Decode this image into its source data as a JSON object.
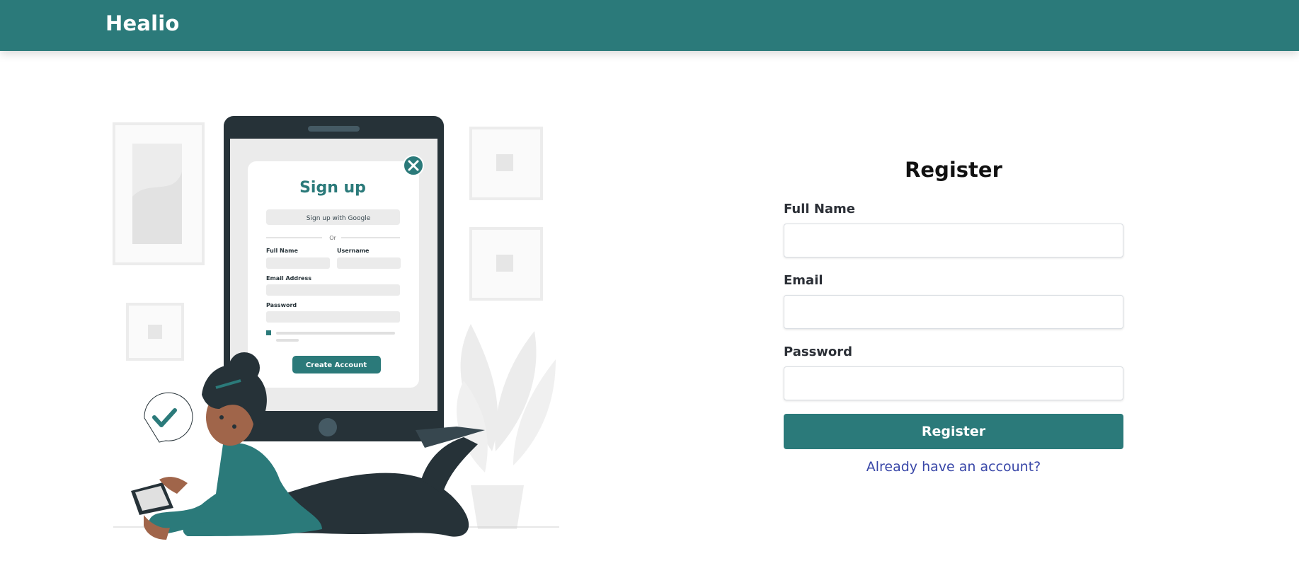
{
  "navbar": {
    "brand": "Healio"
  },
  "illustration": {
    "card_title": "Sign up",
    "google_button": "Sign up with Google",
    "divider": "Or",
    "full_name_label": "Full Name",
    "username_label": "Username",
    "email_label": "Email Address",
    "password_label": "Password",
    "create_button": "Create Account"
  },
  "form": {
    "title": "Register",
    "full_name": {
      "label": "Full Name",
      "value": "",
      "placeholder": ""
    },
    "email": {
      "label": "Email",
      "value": "",
      "placeholder": ""
    },
    "password": {
      "label": "Password",
      "value": "",
      "placeholder": ""
    },
    "submit_label": "Register",
    "login_link": "Already have an account?"
  },
  "colors": {
    "brand": "#2b7a7a",
    "link": "#3947a8"
  }
}
